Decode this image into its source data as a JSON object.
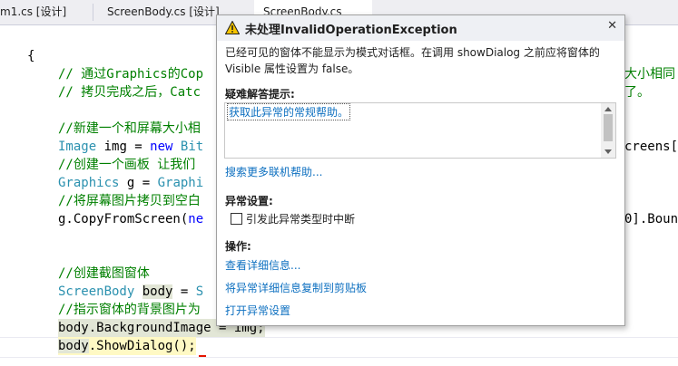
{
  "tabs": [
    {
      "label": "m1.cs [设计]"
    },
    {
      "label": "ScreenBody.cs [设计]"
    },
    {
      "label": "ScreenBody.cs"
    }
  ],
  "code": {
    "l0": "{",
    "l1": "// 通过Graphics的Cop",
    "l1r": "大小相同",
    "l2": "// 拷贝完成之后，Catc",
    "l2r": "了。",
    "l4": "//新建一个和屏幕大小相",
    "l5a": "Image",
    "l5b": " img = ",
    "l5c": "new",
    "l5d": " Bit",
    "l5r": "creens[",
    "l6": "//创建一个画板 让我们",
    "l7a": "Graphics",
    "l7b": " g = ",
    "l7c": "Graphi",
    "l8": "//将屏幕图片拷贝到空白",
    "l9a": "g.CopyFromScreen(",
    "l9b": "ne",
    "l9r": "0].Boun",
    "l12": "//创建截图窗体",
    "l13a": "ScreenBody",
    "l13b": "body",
    "l13c": " = ",
    "l13d": "S",
    "l14": "//指示窗体的背景图片为",
    "l15": "body.BackgroundImage = img;",
    "l16a": "body",
    "l16b": ".ShowDialog();"
  },
  "popup": {
    "title": "未处理InvalidOperationException",
    "close": "✕",
    "message": "已经可见的窗体不能显示为模式对话框。在调用 showDialog 之前应将窗体的 Visible 属性设置为 false。",
    "tips_header": "疑难解答提示:",
    "tip_link": "获取此异常的常规帮助。",
    "search_more": "搜索更多联机帮助...",
    "exception_settings_header": "异常设置:",
    "break_checkbox_label": "引发此异常类型时中断",
    "break_checked": false,
    "actions_header": "操作:",
    "action_view_details": "查看详细信息...",
    "action_copy": "将异常详细信息复制到剪贴板",
    "action_open_settings": "打开异常设置"
  },
  "colors": {
    "comment": "#008000",
    "type": "#2b91af",
    "keyword": "#0000ff",
    "link": "#0e70c0",
    "error": "#e51400"
  }
}
